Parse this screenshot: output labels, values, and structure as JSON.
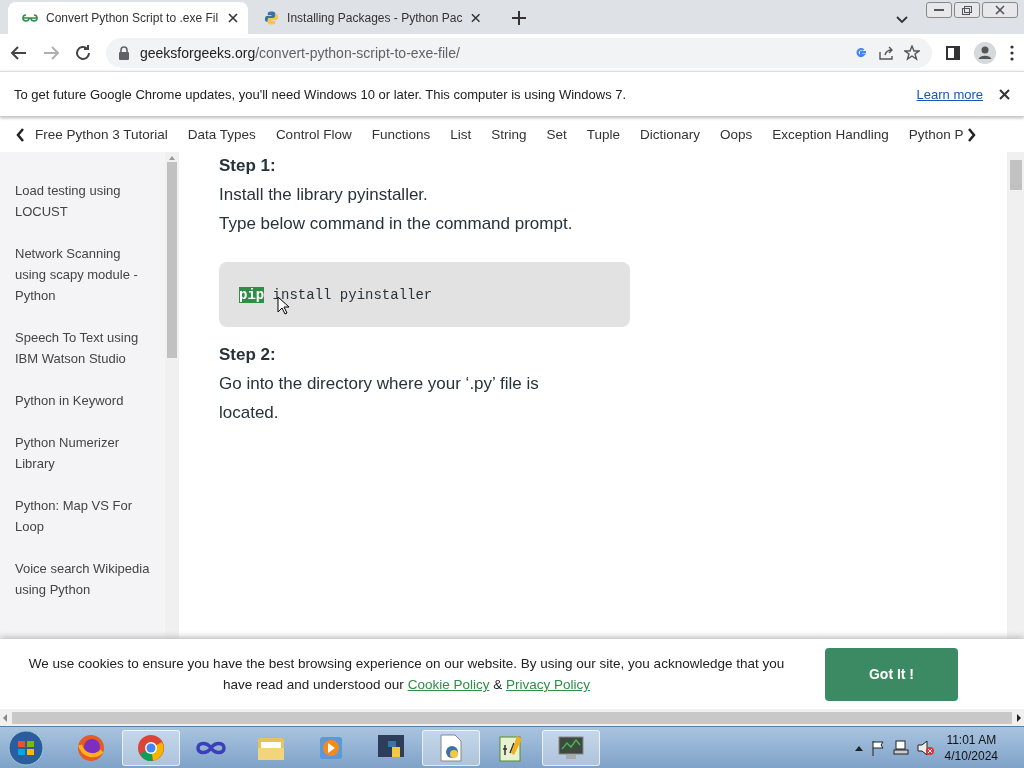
{
  "tabs": [
    {
      "title": "Convert Python Script to .exe Fil",
      "selected": true
    },
    {
      "title": "Installing Packages - Python Pac",
      "selected": false
    }
  ],
  "address": {
    "host": "geeksforgeeks.org",
    "path": "/convert-python-script-to-exe-file/"
  },
  "nav_buttons": [
    {
      "kind": "back",
      "disabled": false
    },
    {
      "kind": "forward",
      "disabled": true
    },
    {
      "kind": "reload",
      "disabled": false
    }
  ],
  "infobar": {
    "message": "To get future Google Chrome updates, you'll need Windows 10 or later. This computer is using Windows 7.",
    "link": "Learn more"
  },
  "topics": [
    "Free Python 3 Tutorial",
    "Data Types",
    "Control Flow",
    "Functions",
    "List",
    "String",
    "Set",
    "Tuple",
    "Dictionary",
    "Oops",
    "Exception Handling",
    "Python P"
  ],
  "sidebar": [
    "Load testing using LOCUST",
    "Network Scanning using scapy module - Python",
    "Speech To Text using IBM Watson Studio",
    "Python in Keyword",
    "Python Numerizer Library",
    "Python: Map VS For Loop",
    "Voice search Wikipedia using Python"
  ],
  "article": [
    {
      "kind": "heading",
      "text": "Step 1:"
    },
    {
      "kind": "para",
      "text": "Install the library pyinstaller."
    },
    {
      "kind": "para",
      "text": "Type below command in the command prompt."
    },
    {
      "kind": "code",
      "selected": "pip",
      "rest": " install pyinstaller"
    },
    {
      "kind": "heading",
      "text": "Step 2:"
    },
    {
      "kind": "para",
      "text": "Go into the directory where your ‘.py’ file is located."
    }
  ],
  "cookie": {
    "text": "We use cookies to ensure you have the best browsing experience on our website. By using our site, you acknowledge that you have read and understood our",
    "link1": "Cookie Policy",
    "joiner": "&",
    "link2": "Privacy Policy",
    "button": "Got It !"
  },
  "taskbar": [
    {
      "kind": "firefox",
      "open": false
    },
    {
      "kind": "chrome",
      "open": true
    },
    {
      "kind": "infinity",
      "open": false
    },
    {
      "kind": "folder",
      "open": false
    },
    {
      "kind": "media",
      "open": false
    },
    {
      "kind": "python",
      "open": false
    },
    {
      "kind": "pyfile",
      "open": true
    },
    {
      "kind": "notepad",
      "open": false
    },
    {
      "kind": "monitor",
      "open": true
    }
  ],
  "clock": {
    "time": "11:01 AM",
    "date": "4/10/2024"
  }
}
